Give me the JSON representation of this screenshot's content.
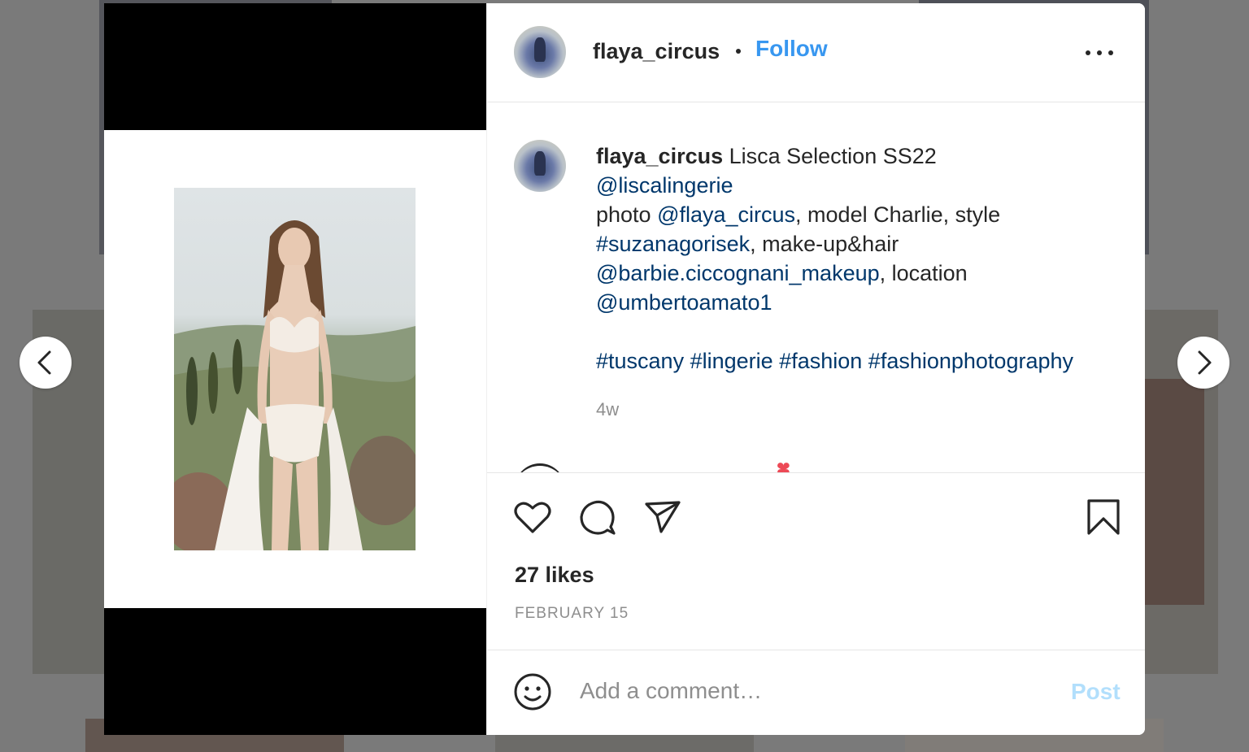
{
  "post": {
    "username": "flaya_circus",
    "separator": "•",
    "follow_label": "Follow",
    "more_icon": "more-horizontal-icon"
  },
  "caption": {
    "username": "flaya_circus",
    "text_1": " Lisca Selection SS22",
    "mention_1": "@liscalingerie",
    "text_2": "photo ",
    "mention_2": "@flaya_circus",
    "text_3": ", model Charlie, style",
    "hashtag_1": "#suzanagorisek",
    "text_4": ", make-up&hair",
    "mention_3": "@barbie.ciccognani_makeup",
    "text_5": ", location",
    "mention_4": "@umbertoamato1",
    "hashtags": [
      "#tuscany",
      "#lingerie",
      "#fashion",
      "#fashionphotography"
    ],
    "time_ago": "4w"
  },
  "actions": {
    "like_icon": "heart-icon",
    "comment_icon": "comment-icon",
    "share_icon": "send-icon",
    "save_icon": "bookmark-icon"
  },
  "likes": "27 likes",
  "date": "FEBRUARY 15",
  "comment_box": {
    "emoji_icon": "smiley-icon",
    "placeholder": "Add a comment…",
    "post_label": "Post"
  },
  "colors": {
    "follow": "#3897f0",
    "link": "#00376b",
    "post_disabled": "#b2dffc",
    "text": "#262626",
    "muted": "#8e8e8e"
  }
}
